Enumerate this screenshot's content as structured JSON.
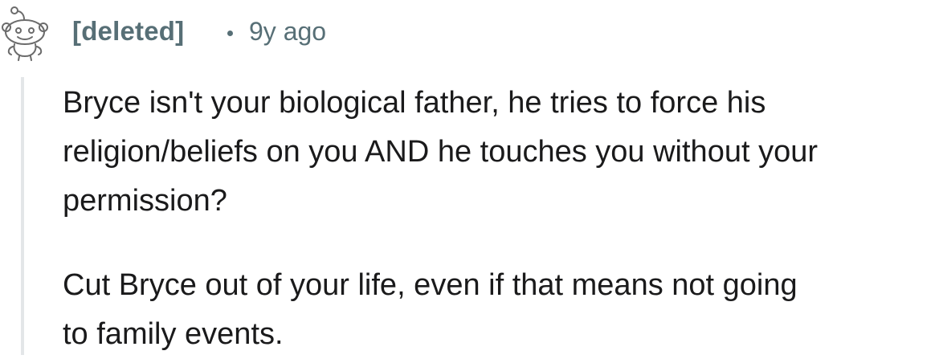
{
  "comment": {
    "author": "[deleted]",
    "separator": "•",
    "timestamp": "9y ago",
    "avatar_icon": "snoo-outline-icon",
    "paragraphs": [
      "Bryce isn't your biological father, he tries to force his\nreligion/beliefs on you AND he touches you without your\npermission?",
      "Cut Bryce out of your life, even if that means not going\nto family events."
    ]
  },
  "colors": {
    "meta_text": "#576f76",
    "body_text": "#1a1a1b",
    "thread_line": "#e3e6e8",
    "background": "#ffffff"
  }
}
